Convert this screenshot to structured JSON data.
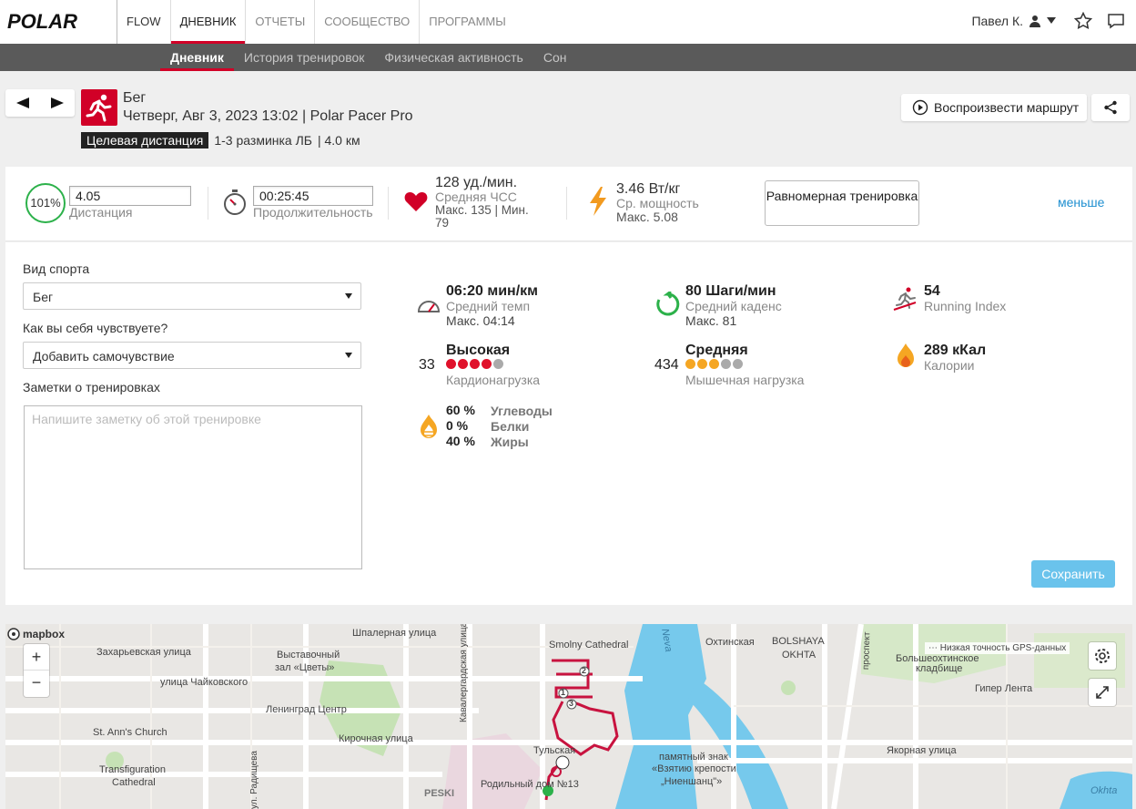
{
  "brand": {
    "logo_text": "POLAR",
    "flow": "FLOW"
  },
  "topnav": {
    "items": [
      "ДНЕВНИК",
      "ОТЧЕТЫ",
      "СООБЩЕСТВО",
      "ПРОГРАММЫ"
    ]
  },
  "user": {
    "name": "Павел К."
  },
  "subnav": {
    "items": [
      "Дневник",
      "История тренировок",
      "Физическая активность",
      "Сон"
    ]
  },
  "session": {
    "sport": "Бег",
    "datetime_device": "Четверг, Авг 3, 2023 13:02 | Polar Pacer Pro",
    "target_tag": "Целевая дистанция",
    "target_desc": "1-3 разминка ЛБ",
    "target_dist": "| 4.0 км"
  },
  "actions": {
    "replay": "Воспроизвести маршрут"
  },
  "summary": {
    "percent": "101%",
    "distance_value": "4.05",
    "distance_label": "Дистанция",
    "duration_value": "00:25:45",
    "duration_label": "Продолжительность",
    "hr_value": "128 уд./мин.",
    "hr_label": "Средняя ЧСС",
    "hr_maxmin_1": "Макс. 135  |  Мин.",
    "hr_maxmin_2": "79",
    "power_value": "3.46 Вт/кг",
    "power_label": "Ср. мощность",
    "power_max": "Макс. 5.08",
    "even_button": "Равномерная тренировка",
    "less_link": "меньше"
  },
  "form": {
    "sport_label": "Вид спорта",
    "sport_value": "Бег",
    "feeling_label": "Как вы себя чувствуете?",
    "feeling_value": "Добавить самочувствие",
    "notes_label": "Заметки о тренировках",
    "notes_placeholder": "Напишите заметку об этой тренировке",
    "save": "Сохранить"
  },
  "stats": {
    "pace_value": "06:20 мин/км",
    "pace_label": "Средний темп",
    "pace_max": "Макс. 04:14",
    "cadence_value": "80 Шаги/мин",
    "cadence_label": "Средний каденс",
    "cadence_max": "Макс. 81",
    "ri_value": "54",
    "ri_label": "Running Index",
    "cardio_num": "33",
    "cardio_value": "Высокая",
    "cardio_label": "Кардионагрузка",
    "cardio_level": 4,
    "muscle_num": "434",
    "muscle_value": "Средняя",
    "muscle_label": "Мышечная нагрузка",
    "muscle_level": 3,
    "cal_value": "289 кКал",
    "cal_label": "Калории",
    "carb_pct": "60 %",
    "carb_label": "Углеводы",
    "prot_pct": "0 %",
    "prot_label": "Белки",
    "fat_pct": "40 %",
    "fat_label": "Жиры"
  },
  "map": {
    "brand": "mapbox",
    "gps_note": "Низкая точность GPS-данных",
    "labels": [
      "Шпалерная улица",
      "Захарьевская улица",
      "Выставочный",
      "зал «Цветы»",
      "улица Чайковского",
      "Ленинград Центр",
      "Кирочная улица",
      "St. Ann's Church",
      "Transfiguration",
      "Cathedral",
      "Кавалергардская улица",
      "Smolny Cathedral",
      "Охтинская",
      "BOLSHAYA",
      "OKHTA",
      "проспект",
      "Большеохтинское",
      "кладбище",
      "Гипер Лента",
      "Neva",
      "памятный знак",
      "«Взятию крепости",
      "„Ниеншанц\"»",
      "Якорная улица",
      "Родильный дом №13",
      "PESKI",
      "Тульская",
      "Okhta",
      "ул. Радищева"
    ],
    "route_markers": [
      "1",
      "2",
      "3"
    ]
  },
  "colors": {
    "brand_red": "#d10027",
    "cardio_dot": "#e0112b",
    "muscle_dot": "#f5a623",
    "inactive_dot": "#aaaaaa",
    "save_btn": "#6ac3ec",
    "link": "#1f8fd0",
    "ring": "#2cb14a"
  }
}
